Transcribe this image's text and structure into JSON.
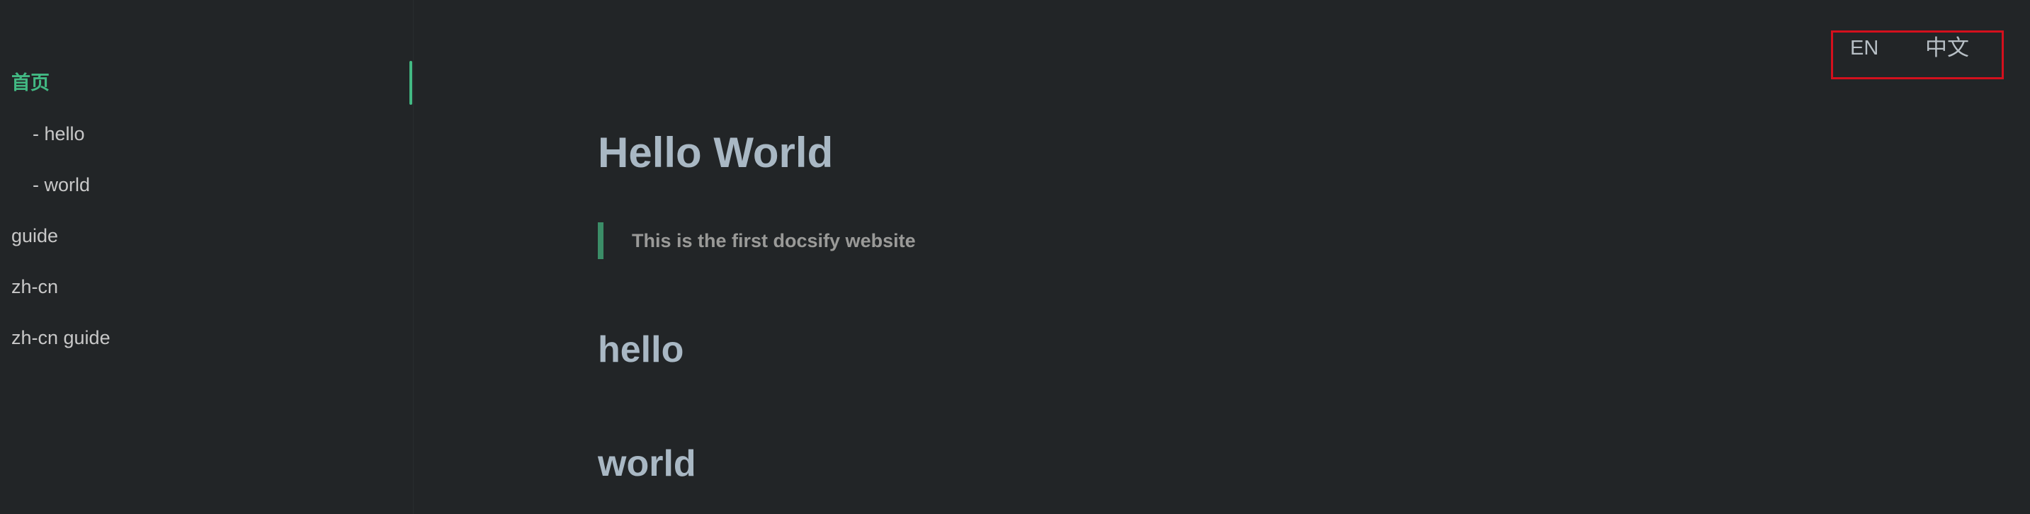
{
  "sidebar": {
    "items": [
      {
        "label": "首页"
      },
      {
        "label": "- hello"
      },
      {
        "label": "- world"
      },
      {
        "label": "guide"
      },
      {
        "label": "zh-cn"
      },
      {
        "label": "zh-cn guide"
      }
    ]
  },
  "language": {
    "en": "EN",
    "zh": "中文"
  },
  "content": {
    "title": "Hello World",
    "quote": "This is the first docsify website",
    "sections": [
      "hello",
      "world"
    ]
  },
  "colors": {
    "background": "#222527",
    "accent": "#42b983",
    "heading": "#a9b8c4",
    "highlight_box": "#d4101d"
  }
}
